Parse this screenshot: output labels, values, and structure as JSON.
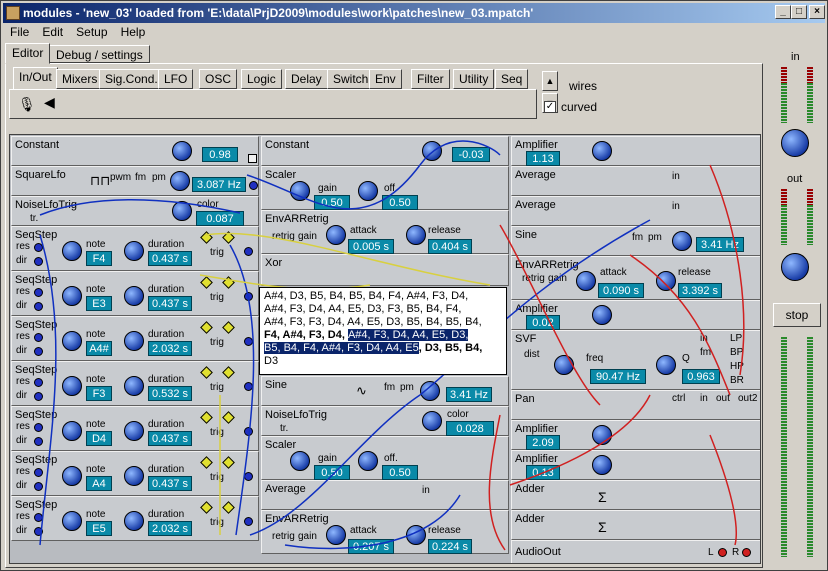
{
  "window": {
    "title": "modules - 'new_03' loaded from 'E:\\data\\PrjD2009\\modules\\work\\patches\\new_03.mpatch'"
  },
  "menu": [
    "File",
    "Edit",
    "Setup",
    "Help"
  ],
  "main_tabs": [
    "Editor",
    "Debug / settings"
  ],
  "palette_tabs": [
    "In/Out",
    "Mixers",
    "Sig.Cond.",
    "LFO",
    "OSC",
    "Logic",
    "Delay",
    "Switch",
    "Env",
    "Filter",
    "Utility",
    "Seq"
  ],
  "options": {
    "wires_label": "wires",
    "curved_label": "curved",
    "curved_checked": true
  },
  "right_panel": {
    "in_label": "in",
    "out_label": "out",
    "stop_label": "stop"
  },
  "modules_col1": [
    {
      "name": "Constant",
      "value": "0.98"
    },
    {
      "name": "SquareLfo",
      "pwm": "pwm",
      "fm": "fm",
      "pm": "pm",
      "value": "3.087 Hz"
    },
    {
      "name": "NoiseLfoTrig",
      "color_label": "color",
      "value": "0.087",
      "tr": "tr."
    },
    {
      "name": "SeqStep",
      "note": "F4",
      "duration": "0.437 s"
    },
    {
      "name": "SeqStep",
      "note": "E3",
      "duration": "0.437 s"
    },
    {
      "name": "SeqStep",
      "note": "A4#",
      "duration": "2.032 s"
    },
    {
      "name": "SeqStep",
      "note": "F3",
      "duration": "0.532 s"
    },
    {
      "name": "SeqStep",
      "note": "D4",
      "duration": "0.437 s"
    },
    {
      "name": "SeqStep",
      "note": "A4",
      "duration": "0.437 s"
    },
    {
      "name": "SeqStep",
      "note": "E5",
      "duration": "2.032 s"
    }
  ],
  "seqstep_labels": {
    "res": "res",
    "dir": "dir",
    "note": "note",
    "duration": "duration",
    "trig": "trig"
  },
  "modules_col2": {
    "constant": {
      "name": "Constant",
      "value": "-0.03"
    },
    "scaler1": {
      "name": "Scaler",
      "gain_label": "gain",
      "off_label": "off.",
      "gain": "0.50",
      "off": "0.50"
    },
    "env1": {
      "name": "EnvARRetrig",
      "retrig": "retrig",
      "gain": "gain",
      "attack_label": "attack",
      "release_label": "release",
      "attack": "0.005 s",
      "release": "0.404 s"
    },
    "xor": {
      "name": "Xor"
    },
    "sine": {
      "name": "Sine",
      "fm": "fm",
      "pm": "pm",
      "value": "3.41 Hz"
    },
    "noise": {
      "name": "NoiseLfoTrig",
      "color_label": "color",
      "value": "0.028",
      "tr": "tr."
    },
    "scaler2": {
      "name": "Scaler",
      "gain_label": "gain",
      "off_label": "off.",
      "gain": "0.50",
      "off": "0.50"
    },
    "average": {
      "name": "Average",
      "in": "in"
    },
    "env2": {
      "name": "EnvARRetrig",
      "retrig": "retrig",
      "gain": "gain",
      "attack_label": "attack",
      "release_label": "release",
      "attack": "0.207 s",
      "release": "0.224 s"
    }
  },
  "modules_col3": {
    "amp1": {
      "name": "Amplifier",
      "value": "1.13"
    },
    "avg1": {
      "name": "Average",
      "in": "in"
    },
    "avg2": {
      "name": "Average",
      "in": "in"
    },
    "sine": {
      "name": "Sine",
      "fm": "fm",
      "pm": "pm",
      "value": "3.41 Hz"
    },
    "env": {
      "name": "EnvARRetrig",
      "retrig": "retrig",
      "gain": "gain",
      "attack_label": "attack",
      "release_label": "release",
      "attack": "0.090 s",
      "release": "3.392 s"
    },
    "amp2": {
      "name": "Amplifier",
      "value": "0.02"
    },
    "svf": {
      "name": "SVF",
      "dist": "dist",
      "freq_label": "freq",
      "q_label": "Q",
      "freq": "90.47 Hz",
      "q": "0.963",
      "lp": "LP",
      "bp": "BP",
      "hp": "HP",
      "br": "BR",
      "in": "in",
      "fm": "fm"
    },
    "pan": {
      "name": "Pan",
      "ctrl": "ctrl",
      "in": "in",
      "out": "out",
      "out2": "out2"
    },
    "amp3": {
      "name": "Amplifier",
      "value": "2.09"
    },
    "amp4": {
      "name": "Amplifier",
      "value": "0.13"
    },
    "adder1": {
      "name": "Adder"
    },
    "adder2": {
      "name": "Adder"
    },
    "audioout": {
      "name": "AudioOut",
      "l": "L",
      "r": "R"
    }
  },
  "tooltip": {
    "line1": "A#4, D3, B5, B4, B5, B4, F4, A#4, F3, D4,",
    "line2": "A#4, F3, D4, A4, E5, D3, F3, B5, B4, F4,",
    "line3": "A#4, F3, F3, D4, A4, E5, D3, B5, B4, B5, B4,",
    "line4a": "F4, A#4, F3, D4, ",
    "line4b": "A#4, F3, D4, A4, E5, D3,",
    "line5a": "B5, B4, F4, A#4, F3, D4, A4, E5",
    "line5b": ", D3, B5, B4,",
    "line6": "D3"
  }
}
